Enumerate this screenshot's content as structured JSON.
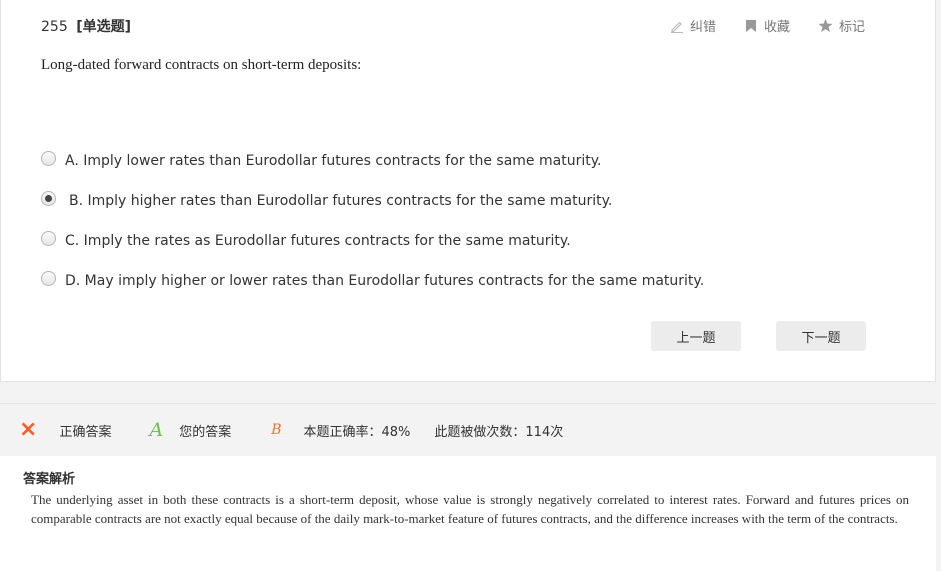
{
  "question": {
    "number": "255",
    "type": "[单选题]",
    "stem": "Long-dated forward contracts on short-term deposits:"
  },
  "tools": [
    {
      "label": "纠错",
      "icon": "pencil-icon"
    },
    {
      "label": "收藏",
      "icon": "bookmark-icon"
    },
    {
      "label": "标记",
      "icon": "star-icon"
    }
  ],
  "options": [
    {
      "text": "A. Imply lower rates than Eurodollar futures contracts for the same maturity.",
      "selected": false
    },
    {
      "text": "B. Imply higher rates than Eurodollar futures contracts for the same maturity.",
      "selected": true
    },
    {
      "text": "C. Imply the rates as Eurodollar futures contracts for the same maturity.",
      "selected": false
    },
    {
      "text": "D. May imply higher or lower rates than Eurodollar futures contracts for the same maturity.",
      "selected": false
    }
  ],
  "nav": {
    "prev": "上一题",
    "next": "下一题"
  },
  "answer_bar": {
    "correct_icon": "×",
    "correct_label": "正确答案",
    "correct_value": "A",
    "yours_label": "您的答案",
    "yours_value": "B",
    "rate": "本题正确率：48%",
    "count": "此题被做次数：114次"
  },
  "analysis": {
    "title": "答案解析",
    "text": "The underlying asset in both these contracts is a short-term deposit, whose value is strongly negatively correlated to interest rates. Forward and futures prices on comparable contracts are not exactly equal because of the daily mark-to-market feature of futures contracts, and the difference increases with the term of the contracts."
  },
  "colors": {
    "wrong": "#ff5a1f",
    "correct": "#6cc24a",
    "your_answer": "#ff6a2a"
  }
}
